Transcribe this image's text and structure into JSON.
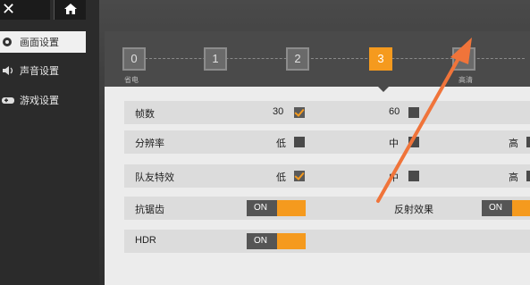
{
  "nav": {
    "back_glyph": "✕",
    "home_icon": "home-icon"
  },
  "sidebar": {
    "items": [
      {
        "label": "画面设置",
        "icon": "gear-icon",
        "active": true
      },
      {
        "label": "声音设置",
        "icon": "speaker-icon",
        "active": false
      },
      {
        "label": "游戏设置",
        "icon": "gamepad-icon",
        "active": false
      }
    ]
  },
  "quality": {
    "levels": [
      "0",
      "1",
      "2",
      "3",
      "4"
    ],
    "selected": "3",
    "label_left": "省电",
    "label_right": "高清"
  },
  "settings": {
    "fps": {
      "label": "帧数",
      "opt1": "30",
      "opt1_checked": true,
      "opt2": "60",
      "opt2_checked": false
    },
    "resolution": {
      "label": "分辨率",
      "opt1": "低",
      "opt2": "中",
      "opt3": "高",
      "checked": "none"
    },
    "teammate_effects": {
      "label": "队友特效",
      "opt1": "低",
      "opt1_checked": true,
      "opt2": "中",
      "opt3": "高"
    },
    "antialias": {
      "label": "抗锯齿",
      "toggle": "ON"
    },
    "reflection": {
      "label": "反射效果",
      "toggle": "ON"
    },
    "hdr": {
      "label": "HDR",
      "toggle": "ON"
    }
  },
  "colors": {
    "accent": "#f59a1e",
    "annotation_arrow": "#f0743a"
  }
}
